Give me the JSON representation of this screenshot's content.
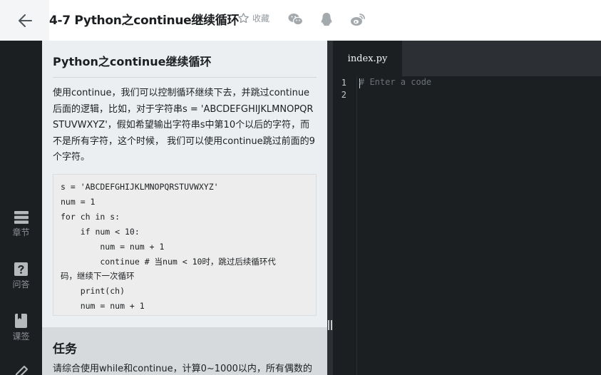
{
  "header": {
    "title": "4-7 Python之continue继续循环",
    "favorite_label": "收藏",
    "share_icons": [
      "wechat-icon",
      "qq-icon",
      "weibo-icon"
    ]
  },
  "sidebar": {
    "items": [
      {
        "label": "章节",
        "icon": "chapter-icon"
      },
      {
        "label": "问答",
        "icon": "question-icon"
      },
      {
        "label": "课签",
        "icon": "bookmark-icon"
      },
      {
        "label": "",
        "icon": "edit-icon"
      }
    ]
  },
  "lesson": {
    "title": "Python之continue继续循环",
    "description": "使用continue，我们可以控制循环继续下去，并跳过continue后面的逻辑，比如，对于字符串s = 'ABCDEFGHIJKLMNOPQRSTUVWXYZ'，假如希望输出字符串s中第10个以后的字符，而不是所有字符，这个时候， 我们可以使用continue跳过前面的9个字符。",
    "code_lines": [
      "s = 'ABCDEFGHIJKLMNOPQRSTUVWXYZ'",
      "num = 1",
      "for ch in s:",
      "    if num < 10:",
      "        num = num + 1",
      "        continue # 当num < 10时，跳过后续循环代",
      "码，继续下一次循环",
      "    print(ch)",
      "    num = num + 1"
    ]
  },
  "task": {
    "title": "任务",
    "text": "请综合使用while和continue，计算0~1000以内，所有偶数的"
  },
  "editor": {
    "tab_label": "index.py",
    "line_numbers": [
      "1",
      "2"
    ],
    "placeholder": "# Enter a code"
  },
  "colors": {
    "sidebar_bg": "#1c1f21",
    "content_bg": "#eceff1",
    "editor_bg": "#1c1f21",
    "tabbar_bg": "#2c3034"
  }
}
